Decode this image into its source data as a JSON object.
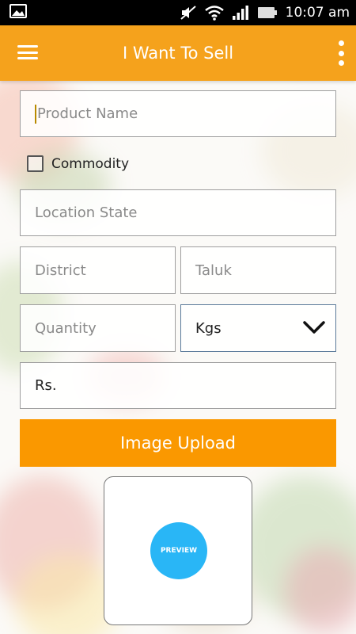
{
  "status_bar": {
    "time": "10:07 am",
    "icons": [
      "image-icon",
      "mute-icon",
      "wifi-icon",
      "signal-icon",
      "battery-icon"
    ]
  },
  "app_bar": {
    "title": "I Want To Sell",
    "color": "#f5a21c",
    "menu_icon": "hamburger-menu-icon",
    "overflow_icon": "more-vert-icon"
  },
  "form": {
    "product_name": {
      "value": "",
      "placeholder": "Product Name"
    },
    "commodity": {
      "label": "Commodity",
      "checked": false
    },
    "location_state": {
      "value": "",
      "placeholder": "Location State"
    },
    "district": {
      "value": "",
      "placeholder": "District"
    },
    "taluk": {
      "value": "",
      "placeholder": "Taluk"
    },
    "quantity": {
      "value": "",
      "placeholder": "Quantity"
    },
    "unit": {
      "selected": "Kgs"
    },
    "price": {
      "value": "",
      "placeholder": "Rs."
    }
  },
  "upload_button": {
    "label": "Image Upload",
    "color": "#fa9800"
  },
  "preview": {
    "label": "PREVIEW",
    "color": "#29b6f6"
  }
}
